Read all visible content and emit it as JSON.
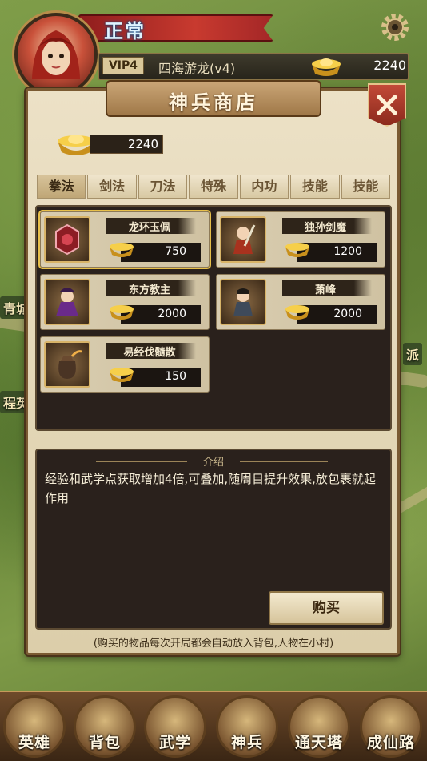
{
  "map": {
    "labels": [
      "青城",
      "程英",
      "派"
    ]
  },
  "header": {
    "status": "正常",
    "vip": "VIP4",
    "server": "四海游龙(v4)",
    "gold": "2240"
  },
  "shop": {
    "title": "神兵商店",
    "ticket_count": "2240",
    "tabs": [
      "拳法",
      "剑法",
      "刀法",
      "特殊",
      "内功",
      "技能",
      "技能"
    ],
    "active_tab": 0,
    "items": [
      {
        "name": "龙环玉佩",
        "price": "750",
        "selected": true
      },
      {
        "name": "独孙剑魔",
        "price": "1200",
        "selected": false
      },
      {
        "name": "东方教主",
        "price": "2000",
        "selected": false
      },
      {
        "name": "萧峰",
        "price": "2000",
        "selected": false
      },
      {
        "name": "易经伐髓散",
        "price": "150",
        "selected": false
      }
    ],
    "description_header": "介绍",
    "description": "经验和武学点获取增加4倍,可叠加,随周目提升效果,放包裹就起作用",
    "buy_label": "购买",
    "footnote": "(购买的物品每次开局都会自动放入背包,人物在小村)"
  },
  "nav": {
    "items": [
      "英雄",
      "背包",
      "武学",
      "神兵",
      "通天塔",
      "成仙路"
    ]
  },
  "colors": {
    "gold": "#e8b83a",
    "accent_red": "#b83226",
    "panel_bg": "#e6dabc",
    "dark_panel": "#2a211c"
  }
}
